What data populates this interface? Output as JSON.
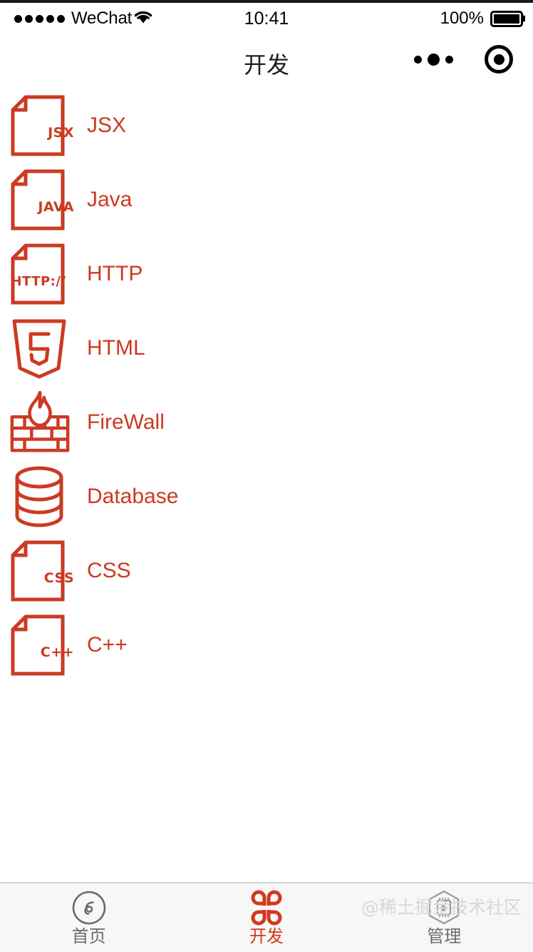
{
  "status_bar": {
    "carrier": "WeChat",
    "signal_dots": 5,
    "wifi_icon": "wifi-icon",
    "time": "10:41",
    "battery_percent": "100%",
    "battery_icon": "battery-full-icon"
  },
  "nav_bar": {
    "title": "开发",
    "menu_icon": "more-dots-icon",
    "close_icon": "target-circle-icon"
  },
  "accent_color": "#cc3a22",
  "tab_active_color": "#d3391c",
  "tab_inactive_color": "#6b6b6b",
  "list": {
    "items": [
      {
        "label": "JSX",
        "icon": "file-jsx-icon",
        "icon_type": "doc",
        "badge": "JSX"
      },
      {
        "label": "Java",
        "icon": "file-java-icon",
        "icon_type": "doc",
        "badge": "JAVA"
      },
      {
        "label": "HTTP",
        "icon": "file-http-icon",
        "icon_type": "doc-wide",
        "badge": "HTTP://"
      },
      {
        "label": "HTML",
        "icon": "html5-shield-icon",
        "icon_type": "html5",
        "badge": "5"
      },
      {
        "label": "FireWall",
        "icon": "firewall-icon",
        "icon_type": "firewall",
        "badge": ""
      },
      {
        "label": "Database",
        "icon": "database-icon",
        "icon_type": "database",
        "badge": ""
      },
      {
        "label": "CSS",
        "icon": "file-css-icon",
        "icon_type": "doc",
        "badge": "CSS"
      },
      {
        "label": "C++",
        "icon": "file-cpp-icon",
        "icon_type": "doc",
        "badge": "C++"
      }
    ]
  },
  "tab_bar": {
    "tabs": [
      {
        "label": "首页",
        "icon": "miniprogram-circle-icon",
        "active": false
      },
      {
        "label": "开发",
        "icon": "clover-grid-icon",
        "active": true
      },
      {
        "label": "管理",
        "icon": "hexagon-chip-icon",
        "active": false
      }
    ]
  },
  "watermark": {
    "text": "@稀土掘金技术社区"
  }
}
